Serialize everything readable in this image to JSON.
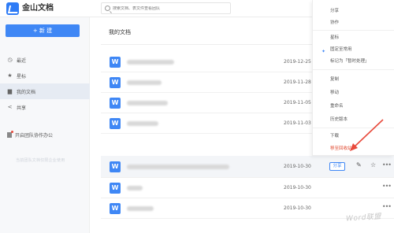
{
  "app": {
    "title": "金山文档"
  },
  "search": {
    "placeholder": "搜索文档、表文件查看团队"
  },
  "sidebar": {
    "new_button": "+ 新 建",
    "items": [
      {
        "label": "最近",
        "icon": "clock-icon"
      },
      {
        "label": "星标",
        "icon": "star-icon"
      },
      {
        "label": "我的文档",
        "icon": "folder-icon",
        "active": true
      },
      {
        "label": "共享",
        "icon": "share-icon"
      }
    ],
    "team_label": "开启团队协作办公",
    "faint_text": "当前团队文档仅限企业使用"
  },
  "main": {
    "title": "我的文档",
    "file_icon_letter": "W",
    "rows": [
      {
        "date": "2019-12-25"
      },
      {
        "date": "2019-11-28"
      },
      {
        "date": "2019-11-05"
      },
      {
        "date": "2019-11-03"
      },
      {
        "date": "2019-10-30",
        "highlighted": true,
        "share": "分享"
      },
      {
        "date": "2019-10-30"
      },
      {
        "date": "2019-10-30"
      }
    ]
  },
  "context_menu": {
    "items": [
      {
        "label": "分享"
      },
      {
        "label": "协作"
      },
      {
        "label": "星标"
      },
      {
        "label": "固定至常用",
        "icon": "pin-icon"
      },
      {
        "label": "标记为「暂时处理」"
      },
      {
        "label": "复制"
      },
      {
        "label": "移动"
      },
      {
        "label": "重命名"
      },
      {
        "label": "历史版本"
      },
      {
        "label": "下载"
      },
      {
        "label": "移至回收站",
        "danger": true
      }
    ]
  },
  "colors": {
    "accent": "#3f87f5",
    "danger": "#e0492f",
    "arrow": "#e84a3c"
  },
  "watermark": "Word联盟"
}
